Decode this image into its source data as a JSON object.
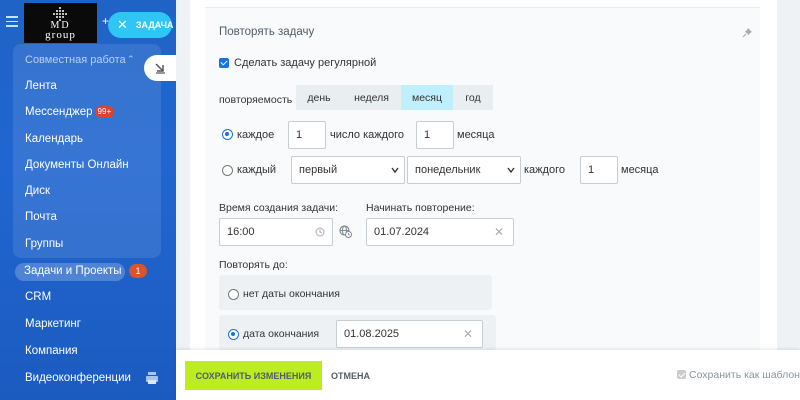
{
  "sidebar": {
    "logo_line1": "MD",
    "logo_line2": "group",
    "group_title": "Совместная работа",
    "items": [
      {
        "label": "Лента"
      },
      {
        "label": "Мессенджер",
        "badge": "99+"
      },
      {
        "label": "Календарь"
      },
      {
        "label": "Документы Онлайн"
      },
      {
        "label": "Диск"
      },
      {
        "label": "Почта"
      },
      {
        "label": "Группы"
      }
    ],
    "active_item": {
      "label": "Задачи и Проекты",
      "badge": "1"
    },
    "lower_items": [
      {
        "label": "CRM"
      },
      {
        "label": "Маркетинг"
      },
      {
        "label": "Компания"
      },
      {
        "label": "Видеоконференции"
      }
    ],
    "task_button_label": "ЗАДАЧА"
  },
  "repeat": {
    "title": "Повторять задачу",
    "make_regular_label": "Сделать задачу регулярной",
    "make_regular_checked": true,
    "frequency_label": "повторяемость",
    "frequency_options": [
      "день",
      "неделя",
      "месяц",
      "год"
    ],
    "frequency_selected": "месяц",
    "row1": {
      "label": "каждое",
      "day_value": "1",
      "mid_text": "число каждого",
      "month_value": "1",
      "end_text": "месяца",
      "selected": true
    },
    "row2": {
      "label": "каждый",
      "ordinal_value": "первый",
      "weekday_value": "понедельник",
      "mid_text": "каждого",
      "month_value": "1",
      "end_text": "месяца",
      "selected": false
    },
    "create_time_label": "Время создания задачи:",
    "create_time_value": "16:00",
    "start_label": "Начинать повторение:",
    "start_value": "01.07.2024",
    "until_label": "Повторять до:",
    "no_end_label": "нет даты окончания",
    "end_date_label": "дата окончания",
    "end_date_value": "01.08.2025",
    "end_mode": "end_date"
  },
  "footer": {
    "save_label": "СОХРАНИТЬ ИЗМЕНЕНИЯ",
    "cancel_label": "ОТМЕНА",
    "template_label": "Сохранить как шаблон",
    "template_checked": true
  },
  "colors": {
    "sidebar_blue": "#1f63c6",
    "accent_cyan": "#2fc6f6",
    "save_green": "#bbed21",
    "selected_segment": "#bfeefc"
  }
}
